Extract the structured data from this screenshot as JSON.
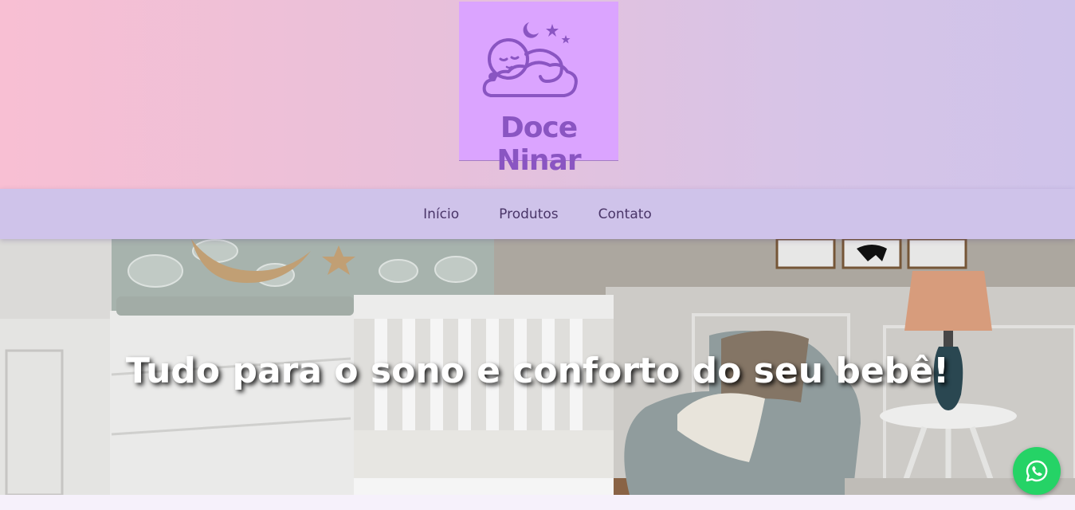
{
  "brand": {
    "name": "Doce Ninar",
    "logo_bg": "#dba4ff",
    "logo_fg": "#8a55c2",
    "icon": "sleeping-baby-on-cloud-icon"
  },
  "nav": {
    "items": [
      {
        "label": "Início"
      },
      {
        "label": "Produtos"
      },
      {
        "label": "Contato"
      }
    ]
  },
  "hero": {
    "title": "Tudo para o sono e conforto do seu bebê!"
  },
  "colors": {
    "header_gradient_start": "#f8bfd3",
    "header_gradient_end": "#cfc3ea",
    "nav_bg": "#cfc3ea",
    "nav_text": "#4a3568",
    "whatsapp_green": "#25d366"
  },
  "floating": {
    "whatsapp_icon": "whatsapp-icon"
  }
}
